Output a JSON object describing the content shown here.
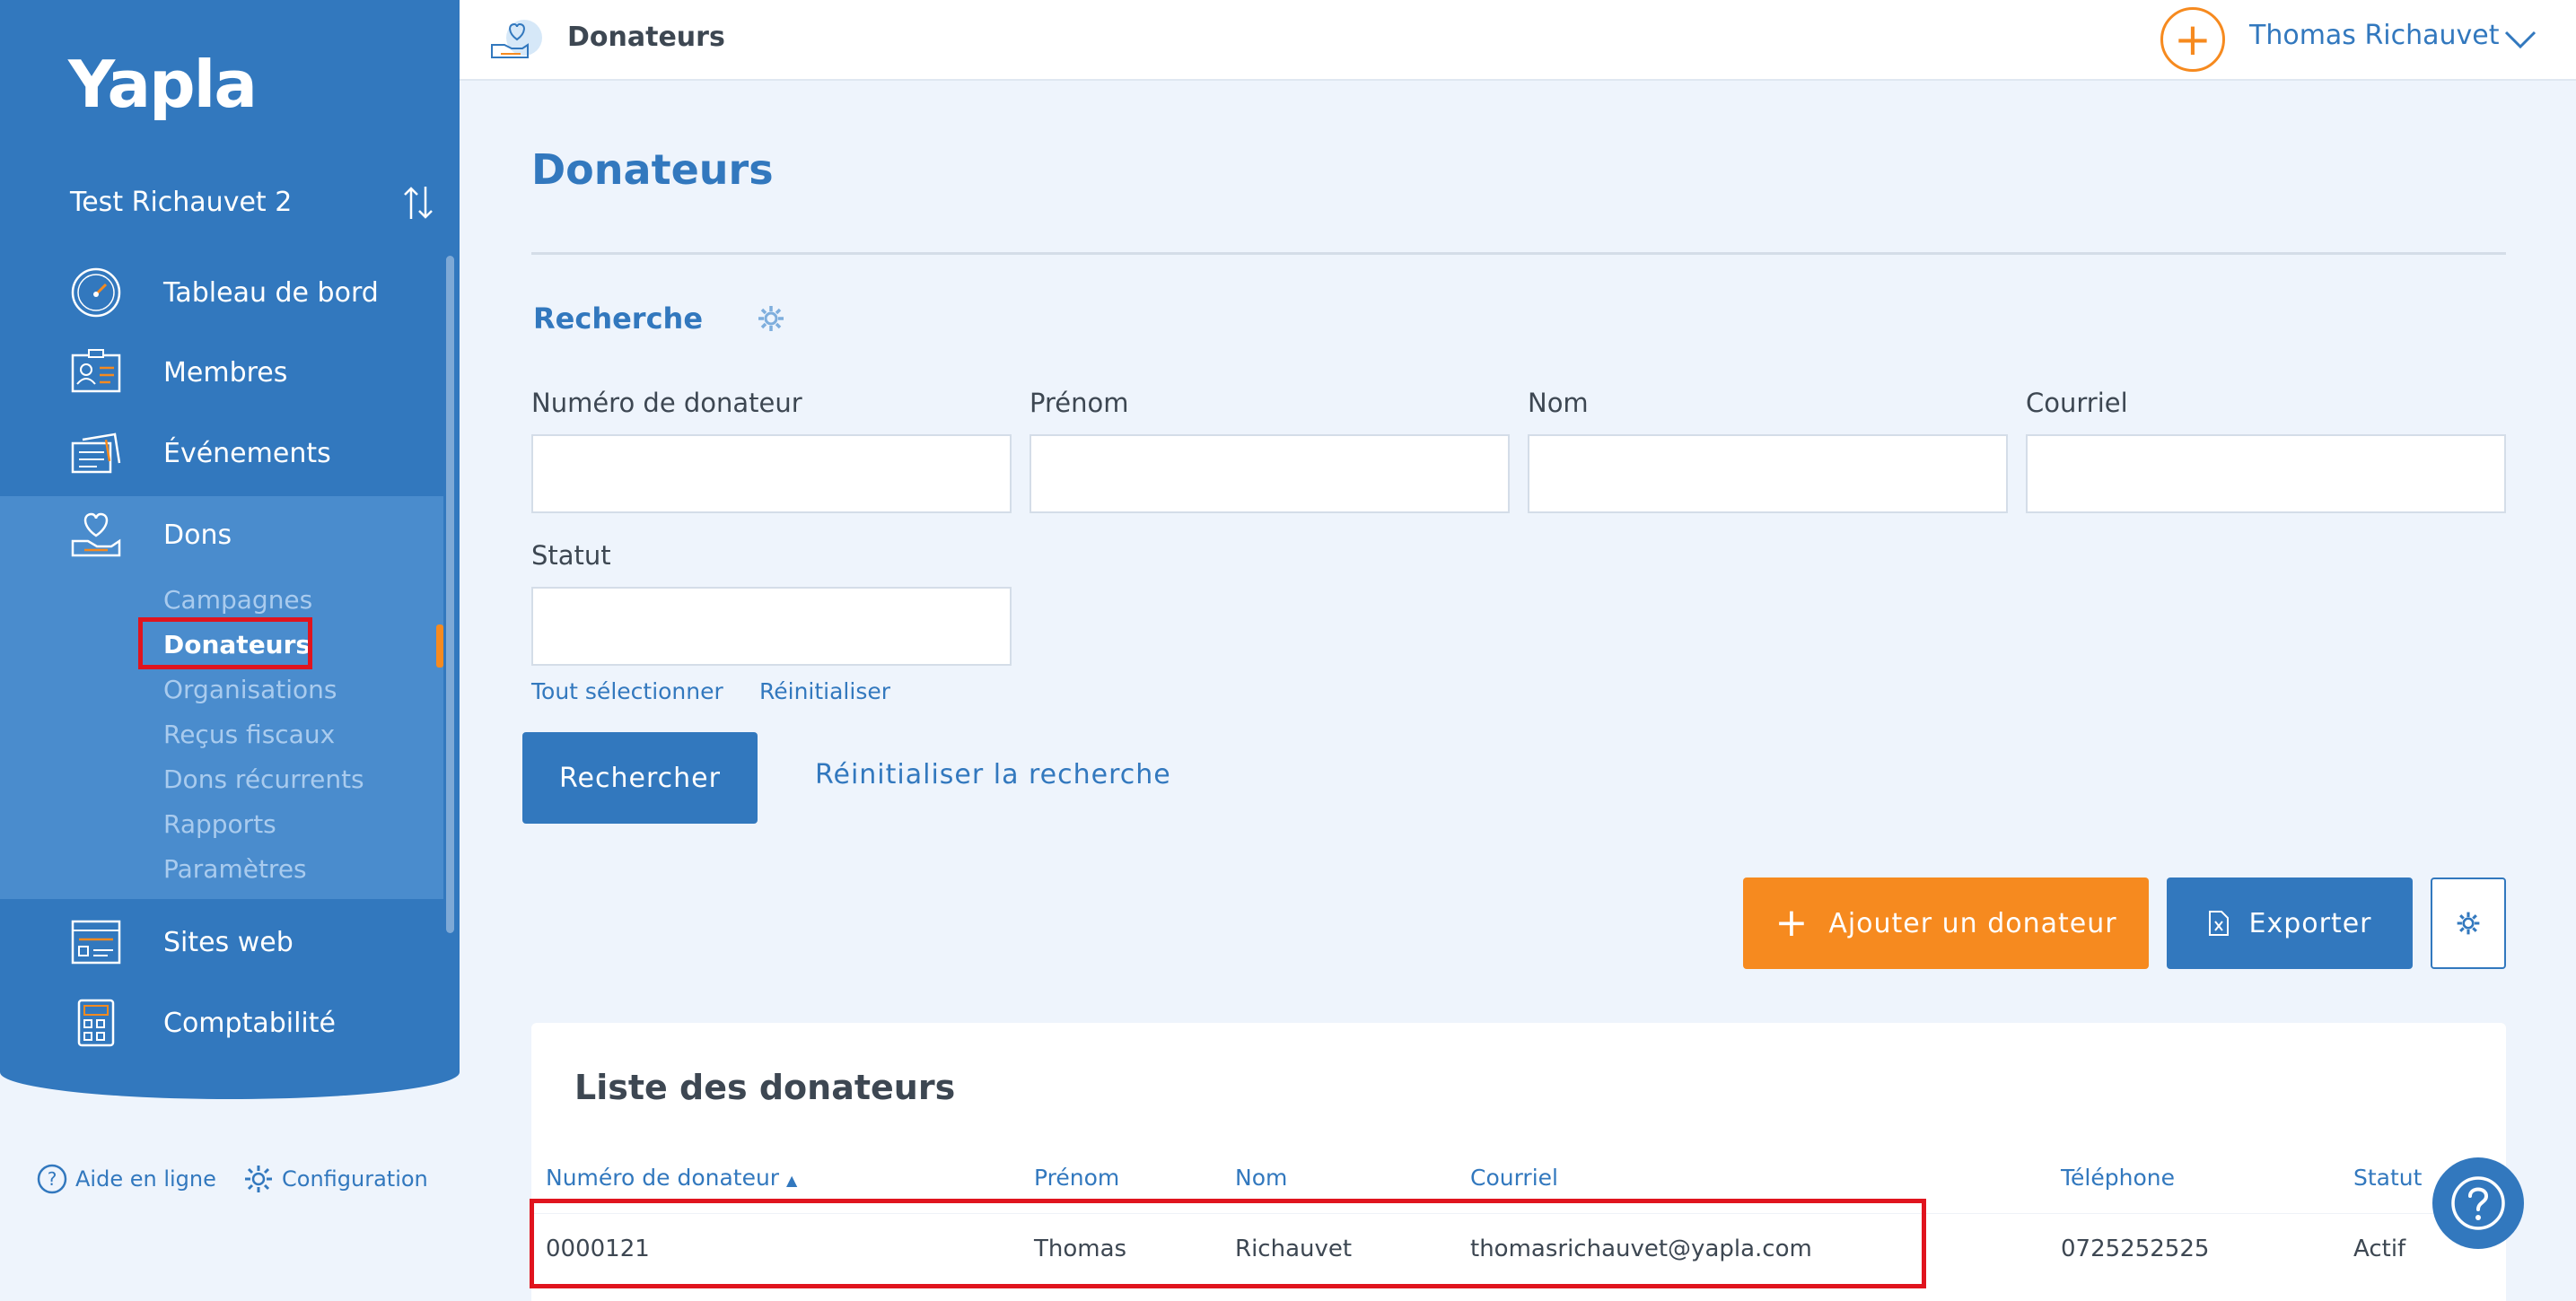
{
  "app": {
    "logo": "Yapla",
    "org_name": "Test Richauvet 2"
  },
  "sidebar": {
    "items": [
      {
        "label": "Tableau de bord",
        "icon": "dashboard-gauge-icon"
      },
      {
        "label": "Membres",
        "icon": "member-card-icon"
      },
      {
        "label": "Événements",
        "icon": "tickets-icon"
      },
      {
        "label": "Dons",
        "icon": "heart-hand-icon"
      },
      {
        "label": "Sites web",
        "icon": "website-icon"
      },
      {
        "label": "Comptabilité",
        "icon": "calculator-icon"
      }
    ],
    "dons_sub": [
      {
        "label": "Campagnes"
      },
      {
        "label": "Donateurs"
      },
      {
        "label": "Organisations"
      },
      {
        "label": "Reçus fiscaux"
      },
      {
        "label": "Dons récurrents"
      },
      {
        "label": "Rapports"
      },
      {
        "label": "Paramètres"
      }
    ],
    "footer": {
      "help": "Aide en ligne",
      "config": "Configuration"
    }
  },
  "topbar": {
    "title": "Donateurs",
    "user": "Thomas Richauvet",
    "plus": "+"
  },
  "main": {
    "title": "Donateurs",
    "search": {
      "title": "Recherche",
      "fields": {
        "numero": "Numéro de donateur",
        "prenom": "Prénom",
        "nom": "Nom",
        "courriel": "Courriel",
        "statut": "Statut"
      },
      "select_all": "Tout sélectionner",
      "reset": "Réinitialiser",
      "submit": "Rechercher",
      "reset_search": "Réinitialiser la recherche"
    },
    "actions": {
      "add": "Ajouter un donateur",
      "add_plus": "+",
      "export": "Exporter"
    },
    "list": {
      "title": "Liste des donateurs",
      "columns": {
        "numero": "Numéro de donateur",
        "prenom": "Prénom",
        "nom": "Nom",
        "courriel": "Courriel",
        "telephone": "Téléphone",
        "statut": "Statut"
      },
      "rows": [
        {
          "numero": "0000121",
          "prenom": "Thomas",
          "nom": "Richauvet",
          "courriel": "thomasrichauvet@yapla.com",
          "telephone": "0725252525",
          "statut": "Actif"
        }
      ]
    }
  },
  "colors": {
    "primary": "#3278be",
    "accent": "#f68a1f",
    "highlight": "#e0141e"
  }
}
